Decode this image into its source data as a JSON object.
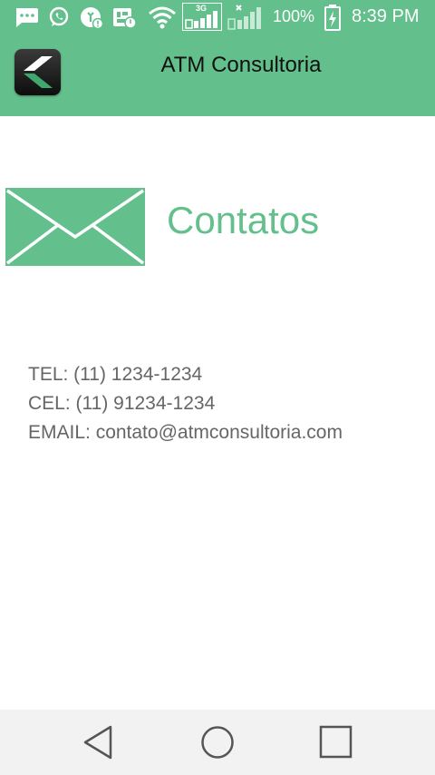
{
  "status_bar": {
    "network_3g": "3G",
    "battery": "100%",
    "time": "8:39 PM"
  },
  "app_bar": {
    "title": "ATM Consultoria"
  },
  "content": {
    "heading": "Contatos",
    "contacts": [
      {
        "text": "TEL: (11) 1234-1234"
      },
      {
        "text": "CEL: (11) 91234-1234"
      },
      {
        "text": "EMAIL: contato@atmconsultoria.com"
      }
    ]
  },
  "colors": {
    "accent": "#63bf8b",
    "text_secondary": "#666666",
    "nav_bar": "#f2f2f2"
  },
  "icons": [
    "message-icon",
    "whatsapp-icon",
    "notification-icon",
    "sim-icon",
    "wifi-icon",
    "signal-icon",
    "signal-x-icon",
    "battery-charging-icon",
    "back-arrow-icon",
    "envelope-icon",
    "nav-back-icon",
    "nav-home-icon",
    "nav-recents-icon"
  ]
}
